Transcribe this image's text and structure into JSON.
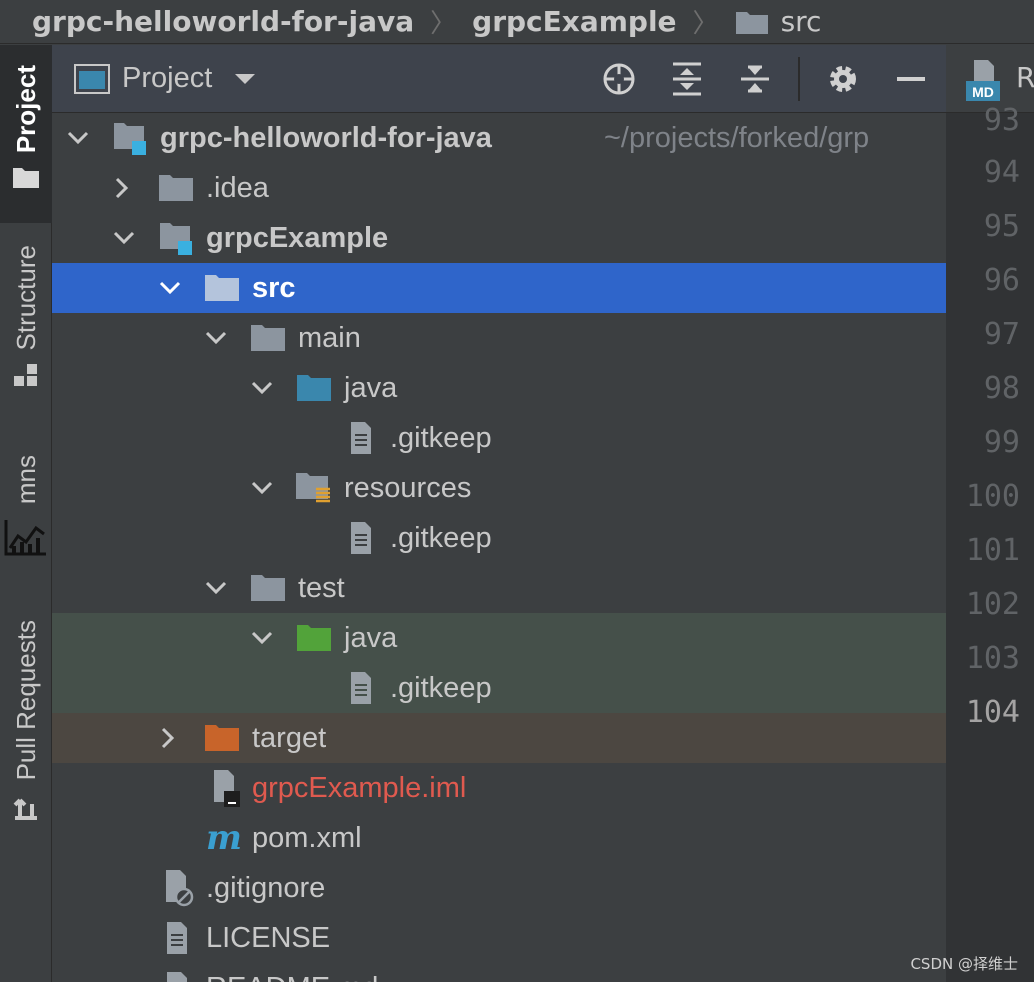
{
  "breadcrumb": {
    "items": [
      "grpc-helloworld-for-java",
      "grpcExample",
      "src"
    ]
  },
  "left_strip": {
    "project": "Project",
    "structure": "Structure",
    "mns": "mns",
    "pull_requests": "Pull Requests"
  },
  "panel": {
    "title": "Project",
    "icons": [
      "locate-icon",
      "expand-all-icon",
      "collapse-all-icon",
      "gear-icon",
      "minimize-icon"
    ]
  },
  "tree": {
    "root_name": "grpc-helloworld-for-java",
    "root_path": "~/projects/forked/grp",
    "idea": ".idea",
    "module": "grpcExample",
    "src": "src",
    "main": "main",
    "main_java": "java",
    "main_java_gitkeep": ".gitkeep",
    "resources": "resources",
    "resources_gitkeep": ".gitkeep",
    "test": "test",
    "test_java": "java",
    "test_java_gitkeep": ".gitkeep",
    "target": "target",
    "iml": "grpcExample.iml",
    "pom": "pom.xml",
    "gitignore": ".gitignore",
    "license": "LICENSE",
    "readme": "README.md"
  },
  "editor": {
    "tab_label": "R",
    "tab_badge": "MD",
    "line_numbers": [
      "93",
      "94",
      "95",
      "96",
      "97",
      "98",
      "99",
      "100",
      "101",
      "102",
      "103",
      "104"
    ],
    "current_line": "104"
  },
  "colors": {
    "selection": "#2f65ca",
    "test_bg": "#45504a",
    "excluded_bg": "#4c4741",
    "source_folder": "#3a87ad",
    "test_folder": "#52a33a",
    "excluded_folder": "#c8642a",
    "ignored_red": "#e05a4f"
  },
  "watermark": "CSDN @择维士"
}
